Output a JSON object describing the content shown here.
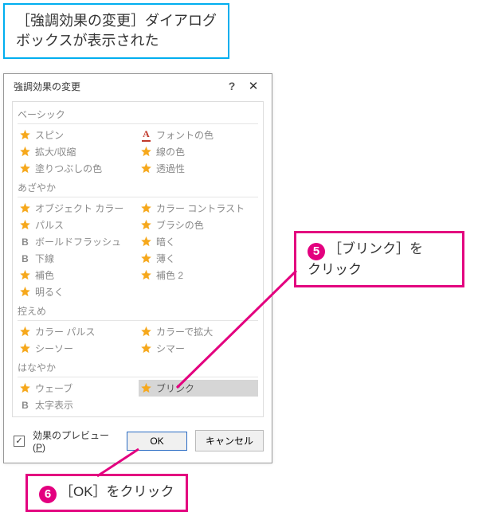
{
  "annotation_top": {
    "line1": "［強調効果の変更］ダイアログ",
    "line2": "ボックスが表示された"
  },
  "dialog": {
    "title": "強調効果の変更",
    "categories": {
      "basic": {
        "label": "ベーシック",
        "items": [
          {
            "label": "スピン",
            "icon": "star"
          },
          {
            "label": "フォントの色",
            "icon": "a"
          },
          {
            "label": "拡大/収縮",
            "icon": "star"
          },
          {
            "label": "線の色",
            "icon": "star"
          },
          {
            "label": "塗りつぶしの色",
            "icon": "star"
          },
          {
            "label": "透過性",
            "icon": "star"
          }
        ]
      },
      "vivid": {
        "label": "あざやか",
        "items": [
          {
            "label": "オブジェクト カラー",
            "icon": "star"
          },
          {
            "label": "カラー コントラスト",
            "icon": "star"
          },
          {
            "label": "パルス",
            "icon": "star"
          },
          {
            "label": "ブラシの色",
            "icon": "star"
          },
          {
            "label": "ボールドフラッシュ",
            "icon": "b"
          },
          {
            "label": "暗く",
            "icon": "star"
          },
          {
            "label": "下線",
            "icon": "b"
          },
          {
            "label": "薄く",
            "icon": "star"
          },
          {
            "label": "補色",
            "icon": "star"
          },
          {
            "label": "補色 2",
            "icon": "star"
          },
          {
            "label": "明るく",
            "icon": "star"
          }
        ]
      },
      "subtle": {
        "label": "控えめ",
        "items": [
          {
            "label": "カラー パルス",
            "icon": "star"
          },
          {
            "label": "カラーで拡大",
            "icon": "star"
          },
          {
            "label": "シーソー",
            "icon": "star"
          },
          {
            "label": "シマー",
            "icon": "star"
          }
        ]
      },
      "ornate": {
        "label": "はなやか",
        "items": [
          {
            "label": "ウェーブ",
            "icon": "star"
          },
          {
            "label": "ブリンク",
            "icon": "star",
            "selected": true
          },
          {
            "label": "太字表示",
            "icon": "b"
          }
        ]
      }
    },
    "preview_checked": "✓",
    "preview_label_pre": "効果のプレビュー(",
    "preview_accel": "P",
    "preview_label_post": ")",
    "ok_label": "OK",
    "cancel_label": "キャンセル"
  },
  "callout5_num": "5",
  "callout5_text1": "［ブリンク］を",
  "callout5_text2": "クリック",
  "callout6_num": "6",
  "callout6_text": "［OK］をクリック"
}
